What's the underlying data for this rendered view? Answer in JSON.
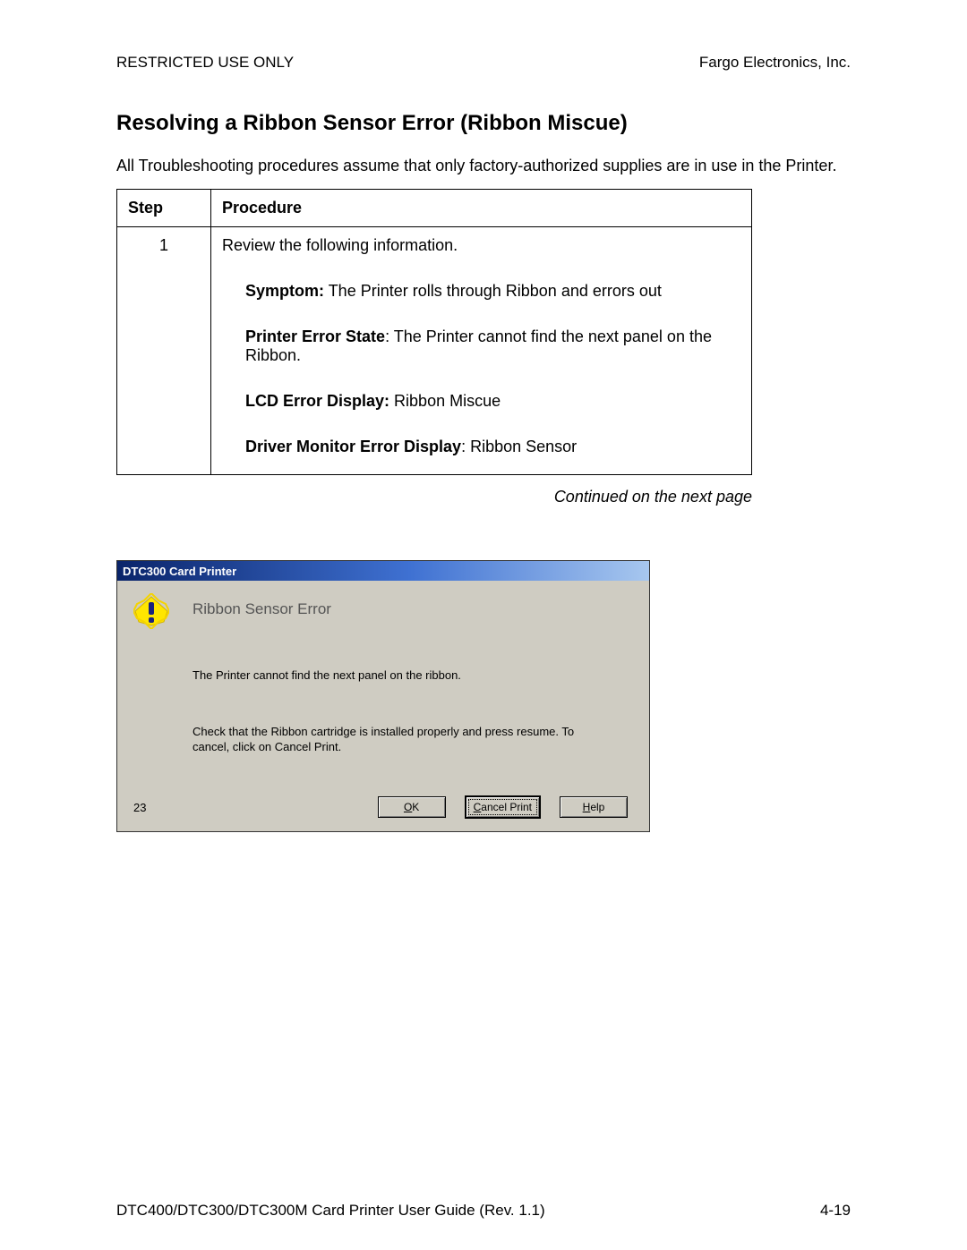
{
  "header": {
    "left": "RESTRICTED USE ONLY",
    "right": "Fargo Electronics, Inc."
  },
  "section_title": "Resolving a Ribbon Sensor Error (Ribbon Miscue)",
  "intro": "All Troubleshooting procedures assume that only factory-authorized supplies are in use in the Printer.",
  "table": {
    "headers": {
      "step": "Step",
      "procedure": "Procedure"
    },
    "step_number": "1",
    "review_line": "Review the following information.",
    "symptom_label": "Symptom:",
    "symptom_text": " The Printer rolls through Ribbon and errors out",
    "error_state_label": "Printer Error State",
    "error_state_text": ": The Printer cannot find the next panel on the Ribbon.",
    "lcd_label": "LCD Error Display:",
    "lcd_text": " Ribbon Miscue",
    "driver_label": "Driver Monitor Error Display",
    "driver_text": ": Ribbon Sensor"
  },
  "continued": "Continued on the next page",
  "dialog": {
    "title": "DTC300 Card Printer",
    "heading": "Ribbon Sensor Error",
    "line1": "The Printer cannot find the next panel on the ribbon.",
    "line2": "Check that the Ribbon cartridge is installed properly and press resume. To cancel, click on Cancel Print.",
    "count": "23",
    "buttons": {
      "ok_u": "O",
      "ok_rest": "K",
      "cancel_u": "C",
      "cancel_rest": "ancel Print",
      "help_u": "H",
      "help_rest": "elp"
    }
  },
  "footer": {
    "left": "DTC400/DTC300/DTC300M Card Printer User Guide (Rev. 1.1)",
    "right": "4-19"
  }
}
